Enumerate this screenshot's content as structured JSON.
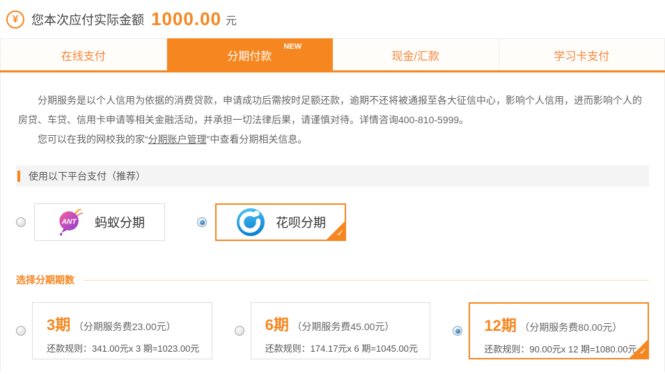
{
  "header": {
    "yen_symbol": "¥",
    "amount_label": "您本次应付实际金额",
    "amount": "1000.00",
    "currency": "元"
  },
  "tabs": [
    {
      "label": "在线支付"
    },
    {
      "label": "分期付款",
      "badge": "NEW"
    },
    {
      "label": "现金/汇款"
    },
    {
      "label": "学习卡支付"
    }
  ],
  "notice": {
    "para1": "分期服务是以个人信用为依据的消费贷款，申请成功后需按时足额还款，逾期不还将被通报至各大征信中心，影响个人信用，进而影响个人的房贷、车贷、信用卡申请等相关金融活动，并承担一切法律后果，请谨慎对待。详情咨询400-810-5999。",
    "para2_prefix": "您可以在我的网校我的家“",
    "para2_link": "分期账户管理",
    "para2_suffix": "”中查看分期相关信息。"
  },
  "platform_section": {
    "title": "使用以下平台支付（推荐）"
  },
  "platforms": [
    {
      "name": "蚂蚁分期",
      "logo": "ant-installment",
      "selected": false
    },
    {
      "name": "花呗分期",
      "logo": "huabei-installment",
      "selected": true
    }
  ],
  "installment_section": {
    "title": "选择分期期数"
  },
  "installments": [
    {
      "periods": "3期",
      "fee_note": "（分期服务费23.00元）",
      "rule": "还款规则：341.00元x 3 期=1023.00元",
      "selected": false
    },
    {
      "periods": "6期",
      "fee_note": "（分期服务费45.00元）",
      "rule": "还款规则：174.17元x 6 期=1045.00元",
      "selected": false
    },
    {
      "periods": "12期",
      "fee_note": "（分期服务费80.00元）",
      "rule": "还款规则：90.00元x 12 期=1080.00元",
      "selected": true
    }
  ],
  "check_mark": "✓",
  "colors": {
    "accent_orange": "#f6861f",
    "radio_selected_blue": "#1a5c9b",
    "huabei_blue": "#1e9ce0",
    "text_gray": "#666666"
  }
}
